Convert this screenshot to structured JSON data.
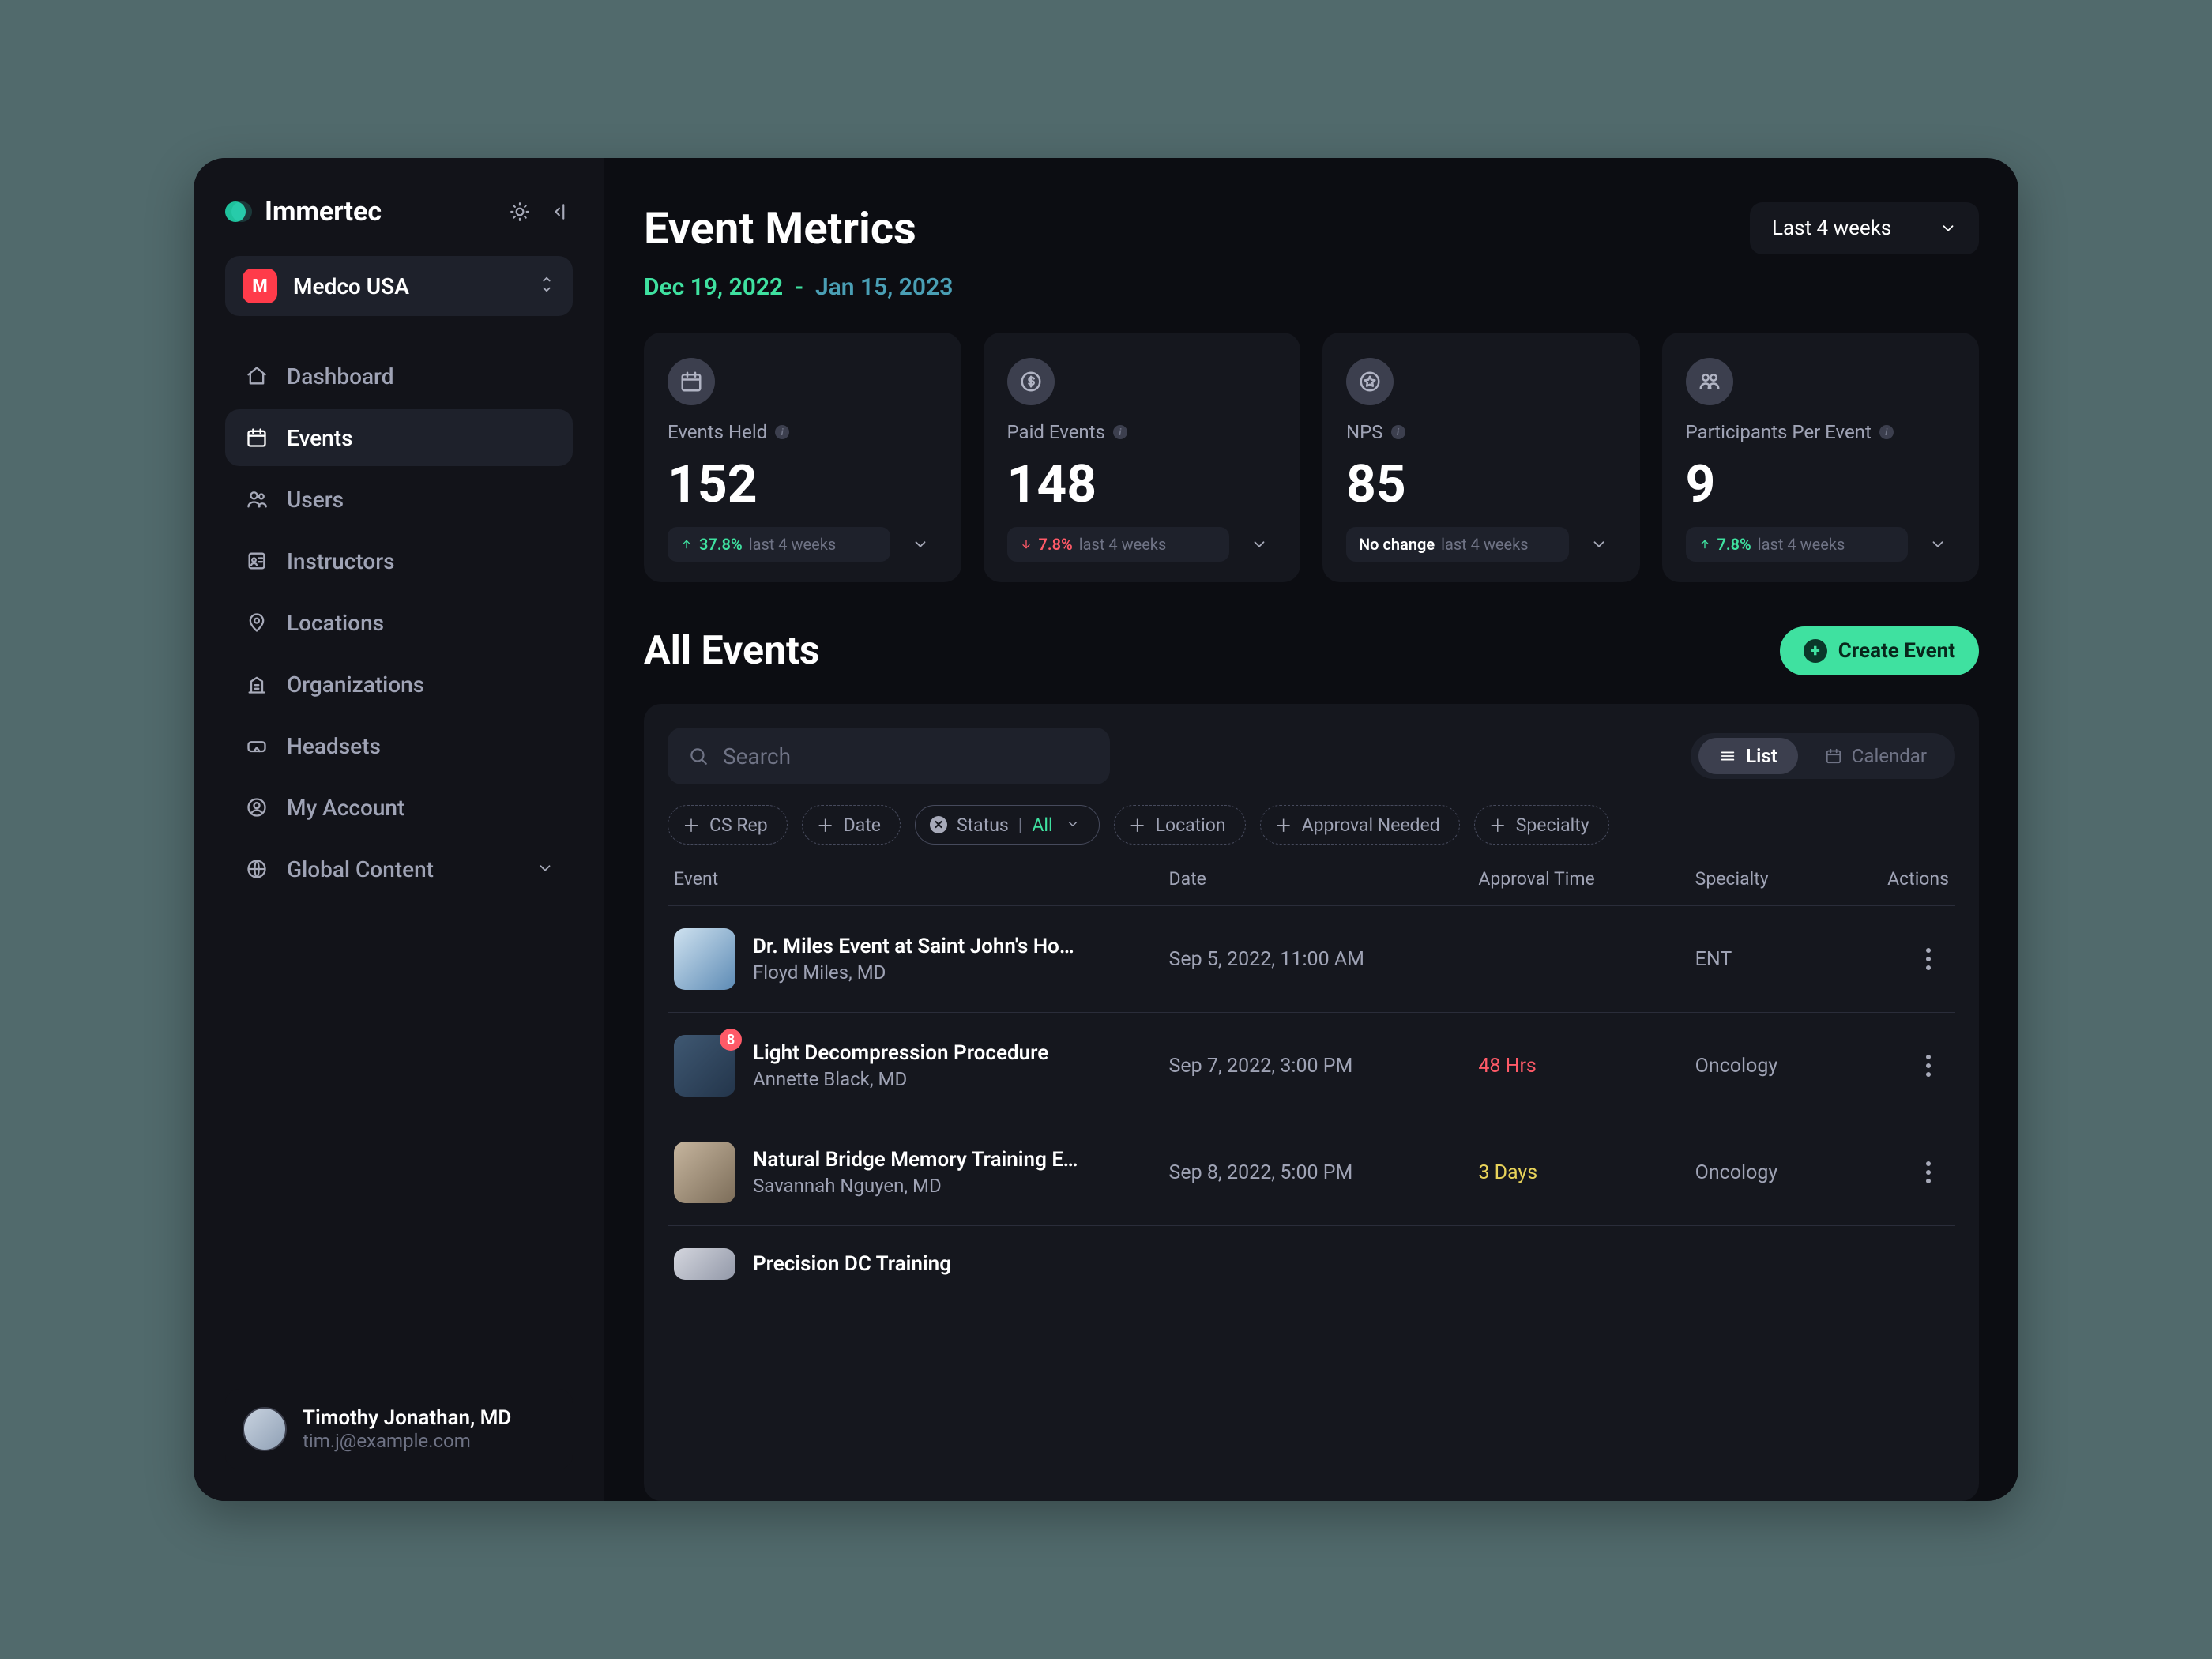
{
  "brand": "Immertec",
  "org": {
    "badge_letter": "M",
    "name": "Medco USA"
  },
  "nav": {
    "items": [
      {
        "label": "Dashboard"
      },
      {
        "label": "Events"
      },
      {
        "label": "Users"
      },
      {
        "label": "Instructors"
      },
      {
        "label": "Locations"
      },
      {
        "label": "Organizations"
      },
      {
        "label": "Headsets"
      },
      {
        "label": "My Account"
      },
      {
        "label": "Global Content"
      }
    ],
    "active_index": 1
  },
  "user": {
    "name": "Timothy Jonathan, MD",
    "email": "tim.j@example.com"
  },
  "header": {
    "title": "Event Metrics",
    "range_label": "Last 4 weeks",
    "date_from": "Dec 19, 2022",
    "date_to": "Jan 15, 2023"
  },
  "metrics": [
    {
      "label": "Events Held",
      "value": "152",
      "delta_dir": "up",
      "delta_pct": "37.8%",
      "delta_period": "last 4 weeks"
    },
    {
      "label": "Paid Events",
      "value": "148",
      "delta_dir": "down",
      "delta_pct": "7.8%",
      "delta_period": "last 4 weeks"
    },
    {
      "label": "NPS",
      "value": "85",
      "delta_dir": "none",
      "delta_pct": "No change",
      "delta_period": "last 4 weeks"
    },
    {
      "label": "Participants Per Event",
      "value": "9",
      "delta_dir": "up",
      "delta_pct": "7.8%",
      "delta_period": "last 4 weeks"
    }
  ],
  "events_section": {
    "title": "All Events",
    "create_label": "Create Event",
    "search_placeholder": "Search",
    "view": {
      "list": "List",
      "calendar": "Calendar",
      "active": "list"
    },
    "filters": {
      "cs_rep": "CS Rep",
      "date": "Date",
      "status_label": "Status",
      "status_value": "All",
      "location": "Location",
      "approval": "Approval Needed",
      "specialty": "Specialty"
    },
    "columns": {
      "event": "Event",
      "date": "Date",
      "approval": "Approval Time",
      "specialty": "Specialty",
      "actions": "Actions"
    },
    "rows": [
      {
        "title": "Dr. Miles Event at Saint John's Hosp...",
        "instructor": "Floyd Miles, MD",
        "date": "Sep 5, 2022, 11:00 AM",
        "approval": "",
        "approval_state": "",
        "specialty": "ENT",
        "notif": ""
      },
      {
        "title": "Light Decompression Procedure",
        "instructor": "Annette Black, MD",
        "date": "Sep 7, 2022, 3:00 PM",
        "approval": "48 Hrs",
        "approval_state": "danger",
        "specialty": "Oncology",
        "notif": "8"
      },
      {
        "title": "Natural Bridge Memory Training Event",
        "instructor": "Savannah Nguyen, MD",
        "date": "Sep 8, 2022, 5:00 PM",
        "approval": "3 Days",
        "approval_state": "warn",
        "specialty": "Oncology",
        "notif": ""
      },
      {
        "title": "Precision DC Training",
        "instructor": "",
        "date": "",
        "approval": "",
        "approval_state": "",
        "specialty": "",
        "notif": ""
      }
    ]
  }
}
